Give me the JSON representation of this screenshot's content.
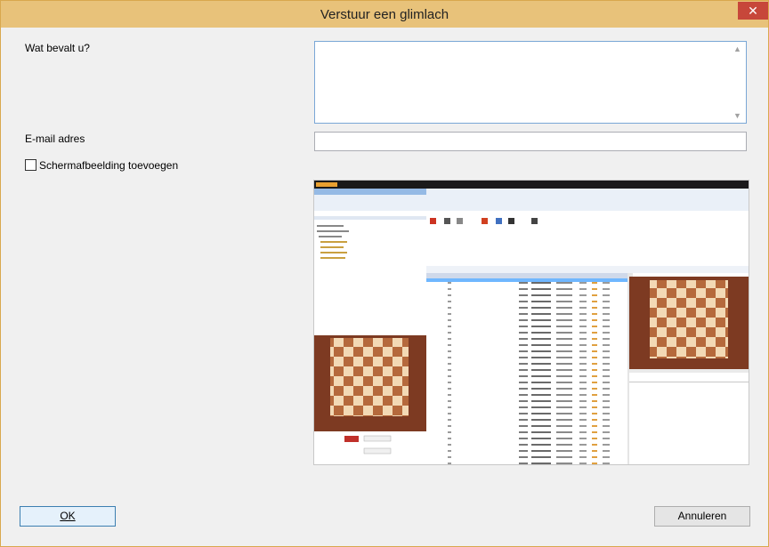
{
  "window": {
    "title": "Verstuur een glimlach",
    "close_glyph": "✕"
  },
  "form": {
    "feedback_label": "Wat bevalt u?",
    "feedback_value": "",
    "email_label": "E-mail adres",
    "email_value": "",
    "screenshot_checkbox_label": "Schermafbeelding toevoegen",
    "screenshot_checked": false
  },
  "buttons": {
    "ok_label": "OK",
    "cancel_label": "Annuleren"
  },
  "icons": {
    "scroll_up": "▲",
    "scroll_down": "▼"
  }
}
